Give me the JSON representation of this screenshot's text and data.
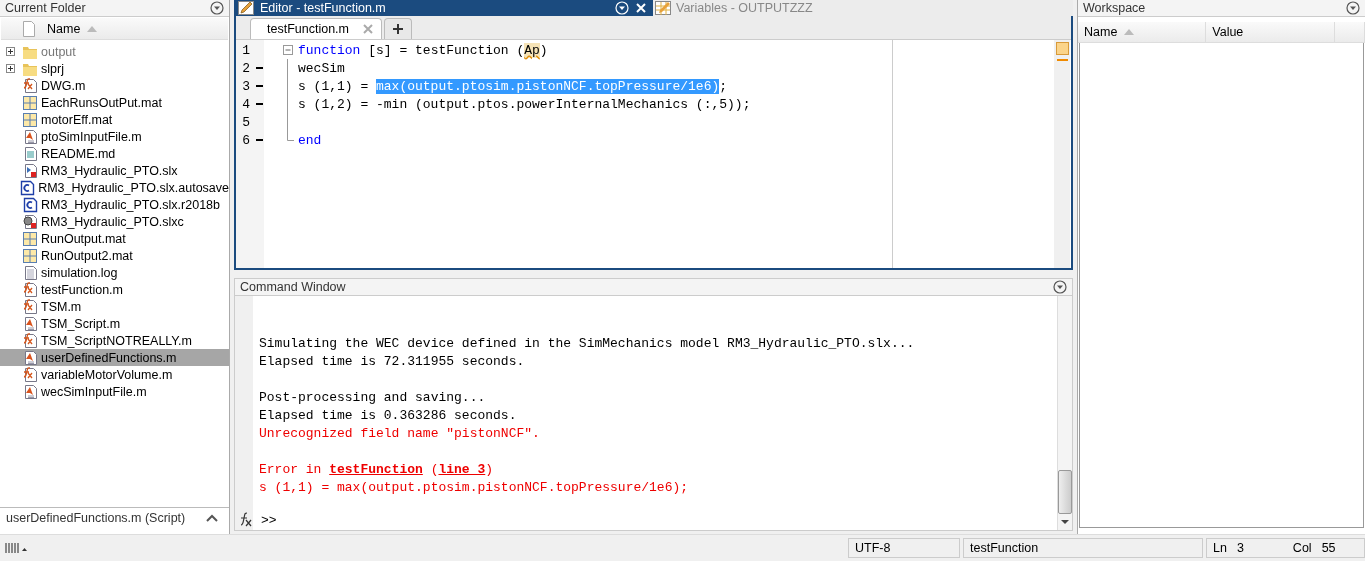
{
  "current_folder": {
    "title": "Current Folder",
    "column": "Name",
    "files": [
      {
        "name": "output",
        "kind": "folder",
        "expandable": true,
        "selected": false
      },
      {
        "name": "slprj",
        "kind": "folder",
        "expandable": true,
        "selected": false
      },
      {
        "name": "DWG.m",
        "kind": "function",
        "selected": false
      },
      {
        "name": "EachRunsOutPut.mat",
        "kind": "mat",
        "selected": false
      },
      {
        "name": "motorEff.mat",
        "kind": "mat",
        "selected": false
      },
      {
        "name": "ptoSimInputFile.m",
        "kind": "script",
        "selected": false
      },
      {
        "name": "README.md",
        "kind": "text",
        "selected": false
      },
      {
        "name": "RM3_Hydraulic_PTO.slx",
        "kind": "model",
        "selected": false
      },
      {
        "name": "RM3_Hydraulic_PTO.slx.autosave",
        "kind": "backup",
        "selected": false
      },
      {
        "name": "RM3_Hydraulic_PTO.slx.r2018b",
        "kind": "backup",
        "selected": false
      },
      {
        "name": "RM3_Hydraulic_PTO.slxc",
        "kind": "cache",
        "selected": false
      },
      {
        "name": "RunOutput.mat",
        "kind": "mat",
        "selected": false
      },
      {
        "name": "RunOutput2.mat",
        "kind": "mat",
        "selected": false
      },
      {
        "name": "simulation.log",
        "kind": "log",
        "selected": false
      },
      {
        "name": "testFunction.m",
        "kind": "function",
        "selected": false
      },
      {
        "name": "TSM.m",
        "kind": "function",
        "selected": false
      },
      {
        "name": "TSM_Script.m",
        "kind": "script",
        "selected": false
      },
      {
        "name": "TSM_ScriptNOTREALLY.m",
        "kind": "function",
        "selected": false
      },
      {
        "name": "userDefinedFunctions.m",
        "kind": "script",
        "selected": true
      },
      {
        "name": "variableMotorVolume.m",
        "kind": "function",
        "selected": false
      },
      {
        "name": "wecSimInputFile.m",
        "kind": "script",
        "selected": false
      }
    ],
    "details": "userDefinedFunctions.m  (Script)"
  },
  "editor": {
    "title": "Editor - testFunction.m",
    "other_panel": "Variables - OUTPUTZZZ",
    "tabs": [
      {
        "label": "testFunction.m",
        "selected": true
      }
    ],
    "lines": [
      {
        "number": "1",
        "executable": false,
        "fold_start": true,
        "segments": [
          {
            "text": "function",
            "kind": "keyword"
          },
          {
            "text": " [s] = testFunction (",
            "kind": "plain"
          },
          {
            "text": "Ap",
            "kind": "warning"
          },
          {
            "text": ")",
            "kind": "plain"
          }
        ]
      },
      {
        "number": "2",
        "executable": true,
        "segments": [
          {
            "text": "wecSim",
            "kind": "plain"
          }
        ]
      },
      {
        "number": "3",
        "executable": true,
        "segments": [
          {
            "text": "s (1,1) = ",
            "kind": "plain"
          },
          {
            "text": "max(output.ptosim.pistonNCF.topPressure/1e6)",
            "kind": "selected"
          },
          {
            "text": ";",
            "kind": "plain"
          }
        ]
      },
      {
        "number": "4",
        "executable": true,
        "segments": [
          {
            "text": "s (1,2) = -min (output.ptos.powerInternalMechanics (:,5));",
            "kind": "plain"
          }
        ]
      },
      {
        "number": "5",
        "executable": false
      },
      {
        "number": "6",
        "executable": true,
        "fold_end": true,
        "segments": [
          {
            "text": "end",
            "kind": "keyword"
          }
        ]
      }
    ]
  },
  "command_window": {
    "title": "Command Window",
    "lines": [
      {
        "kind": "normal",
        "segments": [
          {
            "text": "Simulating the WEC device defined in the SimMechanics model RM3_Hydraulic_PTO.slx...",
            "kind": "plain"
          }
        ]
      },
      {
        "kind": "normal",
        "segments": [
          {
            "text": "Elapsed time is 72.311955 seconds.",
            "kind": "plain"
          }
        ]
      },
      {
        "kind": "blank"
      },
      {
        "kind": "normal",
        "segments": [
          {
            "text": "Post-processing and saving...",
            "kind": "plain"
          }
        ]
      },
      {
        "kind": "normal",
        "segments": [
          {
            "text": "Elapsed time is 0.363286 seconds.",
            "kind": "plain"
          }
        ]
      },
      {
        "kind": "error",
        "segments": [
          {
            "text": "Unrecognized field name \"pistonNCF\".",
            "kind": "plain"
          }
        ]
      },
      {
        "kind": "blank"
      },
      {
        "kind": "error",
        "segments": [
          {
            "text": "Error in ",
            "kind": "plain"
          },
          {
            "text": "testFunction",
            "kind": "link"
          },
          {
            "text": " (",
            "kind": "plain"
          },
          {
            "text": "line 3",
            "kind": "link"
          },
          {
            "text": ")",
            "kind": "plain"
          }
        ]
      },
      {
        "kind": "error",
        "segments": [
          {
            "text": "s (1,1) = max(output.ptosim.pistonNCF.topPressure/1e6);",
            "kind": "plain"
          }
        ]
      }
    ],
    "prompt": ">>"
  },
  "workspace": {
    "title": "Workspace",
    "columns": [
      "Name",
      "Value"
    ]
  },
  "status_bar": {
    "encoding": "UTF-8",
    "function": "testFunction",
    "ln_label": "Ln",
    "ln": "3",
    "col_label": "Col",
    "col": "55"
  }
}
